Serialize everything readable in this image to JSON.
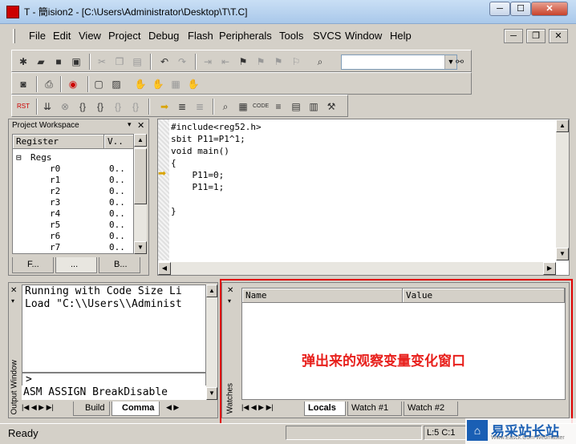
{
  "window": {
    "title": "T  - 簡ision2 - [C:\\Users\\Administrator\\Desktop\\T\\T.C]",
    "min": "─",
    "max": "☐",
    "close": "✕"
  },
  "menu": [
    "File",
    "Edit",
    "View",
    "Project",
    "Debug",
    "Flash",
    "Peripherals",
    "Tools",
    "SVCS",
    "Window",
    "Help"
  ],
  "mdi": {
    "min": "─",
    "restore": "❐",
    "close": "✕"
  },
  "find_combo": {
    "value": "",
    "arrow": "▼"
  },
  "workspace": {
    "title": "Project Workspace",
    "pin": "▾",
    "close": "✕",
    "col_register": "Register",
    "col_value": "V..",
    "regs_label": "Regs",
    "registers": [
      {
        "name": "r0",
        "value": "0.."
      },
      {
        "name": "r1",
        "value": "0.."
      },
      {
        "name": "r2",
        "value": "0.."
      },
      {
        "name": "r3",
        "value": "0.."
      },
      {
        "name": "r4",
        "value": "0.."
      },
      {
        "name": "r5",
        "value": "0.."
      },
      {
        "name": "r6",
        "value": "0.."
      },
      {
        "name": "r7",
        "value": "0.."
      }
    ],
    "tabs": [
      "F...",
      "...",
      "B..."
    ]
  },
  "editor": {
    "lines": [
      "#include<reg52.h>",
      "sbit P11=P1^1;",
      "void main()",
      "{",
      "    P11=0;",
      "    P11=1;",
      "",
      "",
      "}"
    ]
  },
  "output": {
    "side_label": "Output Window",
    "lines": [
      "Running with Code Size Li",
      "Load \"C:\\\\Users\\\\Administ"
    ],
    "prompt": ">",
    "cmdline": "ASM ASSIGN BreakDisable",
    "tabs": [
      "Build",
      "Comma"
    ]
  },
  "watches": {
    "side_label": "Watches",
    "col_name": "Name",
    "col_value": "Value",
    "note": "弹出来的观察变量变化窗口",
    "tabs": [
      "Locals",
      "Watch #1",
      "Watch #2"
    ]
  },
  "status": {
    "text": "Ready",
    "pos": "L:5 C:1"
  },
  "watermark": {
    "text": "易采站长站",
    "sub": "Www.Easck.Com Webmaster"
  },
  "colors": {
    "highlight": "#e00000",
    "note": "#e8201c"
  }
}
